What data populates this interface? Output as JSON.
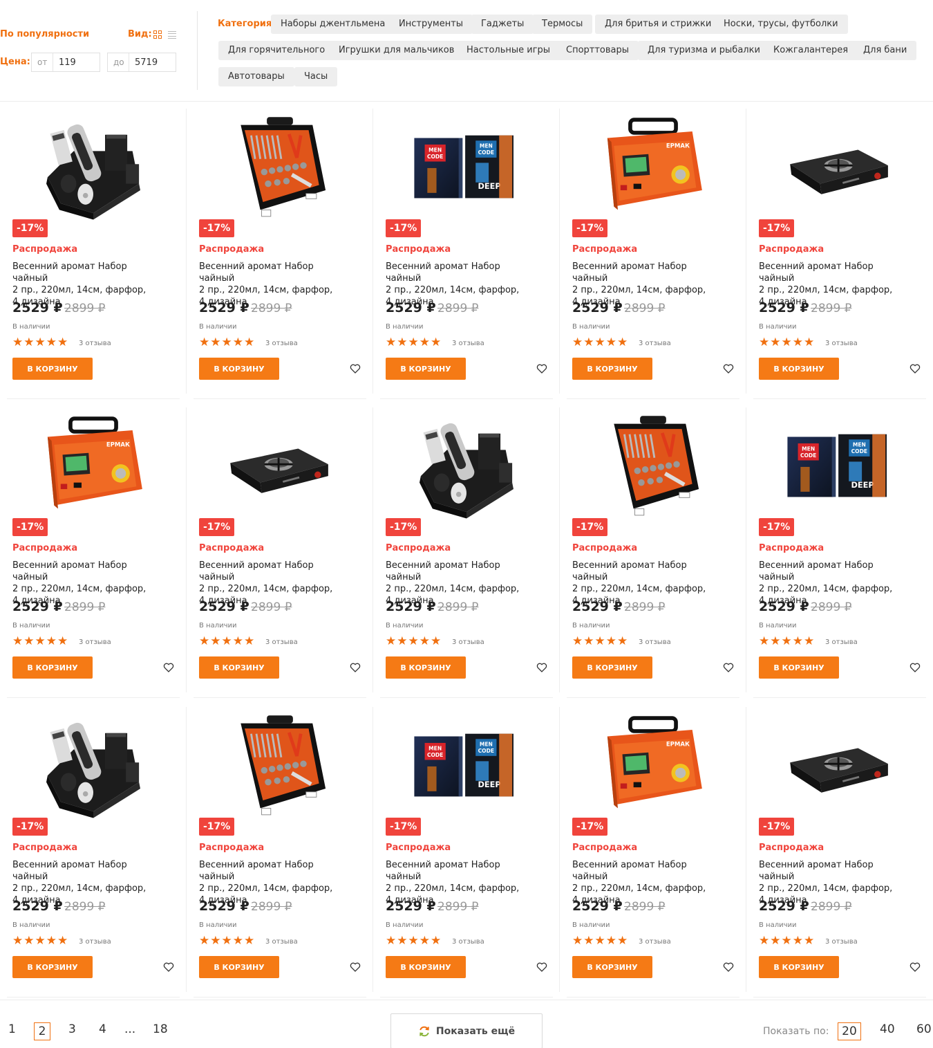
{
  "filters": {
    "sort_label": "По популярности",
    "view_label": "Вид:",
    "price_label": "Цена:",
    "price_from_prefix": "от",
    "price_from_value": "119",
    "price_to_prefix": "до",
    "price_to_value": "5719",
    "category_label": "Категория:",
    "categories": [
      "Наборы джентльмена",
      "Инструменты",
      "Гаджеты",
      "Термосы",
      "Для бритья и стрижки",
      "Носки, трусы, футболки",
      "Для горячительного",
      "Игрушки для мальчиков",
      "Настольные игры",
      "Спорттовары",
      "Для туризма и рыбалки",
      "Кожгалантерея",
      "Для бани",
      "Автотовары",
      "Часы"
    ]
  },
  "products": [
    {
      "image": "trimmer-set-image",
      "discount": "-17%",
      "sale": "Распродажа",
      "title_lines": [
        "Весенний аромат Набор чайный",
        "2 пр., 220мл, 14см, фарфор,",
        "4 дизайна"
      ],
      "price": "2529 ₽",
      "old_price": "2899 ₽",
      "stock": "В наличии",
      "rating": 5,
      "reviews": "3 отзыва",
      "cart": "В КОРЗИНУ"
    },
    {
      "image": "tool-case-image",
      "discount": "-17%",
      "sale": "Распродажа",
      "title_lines": [
        "Весенний аромат Набор чайный",
        "2 пр., 220мл, 14см, фарфор,",
        "4 дизайна"
      ],
      "price": "2529 ₽",
      "old_price": "2899 ₽",
      "stock": "В наличии",
      "rating": 5,
      "reviews": "3 отзыва",
      "cart": "В КОРЗИНУ"
    },
    {
      "image": "men-code-boxes-image",
      "discount": "-17%",
      "sale": "Распродажа",
      "title_lines": [
        "Весенний аромат Набор чайный",
        "2 пр., 220мл, 14см, фарфор,",
        "4 дизайна"
      ],
      "price": "2529 ₽",
      "old_price": "2899 ₽",
      "stock": "В наличии",
      "rating": 5,
      "reviews": "3 отзыва",
      "cart": "В КОРЗИНУ"
    },
    {
      "image": "battery-charger-image",
      "discount": "-17%",
      "sale": "Распродажа",
      "title_lines": [
        "Весенний аромат Набор чайный",
        "2 пр., 220мл, 14см, фарфор,",
        "4 дизайна"
      ],
      "price": "2529 ₽",
      "old_price": "2899 ₽",
      "stock": "В наличии",
      "rating": 5,
      "reviews": "3 отзыва",
      "cart": "В КОРЗИНУ"
    },
    {
      "image": "gas-stove-image",
      "discount": "-17%",
      "sale": "Распродажа",
      "title_lines": [
        "Весенний аромат Набор чайный",
        "2 пр., 220мл, 14см, фарфор,",
        "4 дизайна"
      ],
      "price": "2529 ₽",
      "old_price": "2899 ₽",
      "stock": "В наличии",
      "rating": 5,
      "reviews": "3 отзыва",
      "cart": "В КОРЗИНУ"
    },
    {
      "image": "battery-charger-image",
      "discount": "-17%",
      "sale": "Распродажа",
      "title_lines": [
        "Весенний аромат Набор чайный",
        "2 пр., 220мл, 14см, фарфор,",
        "4 дизайна"
      ],
      "price": "2529 ₽",
      "old_price": "2899 ₽",
      "stock": "В наличии",
      "rating": 5,
      "reviews": "3 отзыва",
      "cart": "В КОРЗИНУ"
    },
    {
      "image": "gas-stove-image",
      "discount": "-17%",
      "sale": "Распродажа",
      "title_lines": [
        "Весенний аромат Набор чайный",
        "2 пр., 220мл, 14см, фарфор,",
        "4 дизайна"
      ],
      "price": "2529 ₽",
      "old_price": "2899 ₽",
      "stock": "В наличии",
      "rating": 5,
      "reviews": "3 отзыва",
      "cart": "В КОРЗИНУ"
    },
    {
      "image": "trimmer-set-image",
      "discount": "-17%",
      "sale": "Распродажа",
      "title_lines": [
        "Весенний аромат Набор чайный",
        "2 пр., 220мл, 14см, фарфор,",
        "4 дизайна"
      ],
      "price": "2529 ₽",
      "old_price": "2899 ₽",
      "stock": "В наличии",
      "rating": 5,
      "reviews": "3 отзыва",
      "cart": "В КОРЗИНУ"
    },
    {
      "image": "tool-case-image",
      "discount": "-17%",
      "sale": "Распродажа",
      "title_lines": [
        "Весенний аромат Набор чайный",
        "2 пр., 220мл, 14см, фарфор,",
        "4 дизайна"
      ],
      "price": "2529 ₽",
      "old_price": "2899 ₽",
      "stock": "В наличии",
      "rating": 5,
      "reviews": "3 отзыва",
      "cart": "В КОРЗИНУ"
    },
    {
      "image": "men-code-boxes-image",
      "discount": "-17%",
      "sale": "Распродажа",
      "title_lines": [
        "Весенний аромат Набор чайный",
        "2 пр., 220мл, 14см, фарфор,",
        "4 дизайна"
      ],
      "price": "2529 ₽",
      "old_price": "2899 ₽",
      "stock": "В наличии",
      "rating": 5,
      "reviews": "3 отзыва",
      "cart": "В КОРЗИНУ"
    },
    {
      "image": "trimmer-set-image",
      "discount": "-17%",
      "sale": "Распродажа",
      "title_lines": [
        "Весенний аромат Набор чайный",
        "2 пр., 220мл, 14см, фарфор,",
        "4 дизайна"
      ],
      "price": "2529 ₽",
      "old_price": "2899 ₽",
      "stock": "В наличии",
      "rating": 5,
      "reviews": "3 отзыва",
      "cart": "В КОРЗИНУ"
    },
    {
      "image": "tool-case-image",
      "discount": "-17%",
      "sale": "Распродажа",
      "title_lines": [
        "Весенний аромат Набор чайный",
        "2 пр., 220мл, 14см, фарфор,",
        "4 дизайна"
      ],
      "price": "2529 ₽",
      "old_price": "2899 ₽",
      "stock": "В наличии",
      "rating": 5,
      "reviews": "3 отзыва",
      "cart": "В КОРЗИНУ"
    },
    {
      "image": "men-code-boxes-image",
      "discount": "-17%",
      "sale": "Распродажа",
      "title_lines": [
        "Весенний аромат Набор чайный",
        "2 пр., 220мл, 14см, фарфор,",
        "4 дизайна"
      ],
      "price": "2529 ₽",
      "old_price": "2899 ₽",
      "stock": "В наличии",
      "rating": 5,
      "reviews": "3 отзыва",
      "cart": "В КОРЗИНУ"
    },
    {
      "image": "battery-charger-image",
      "discount": "-17%",
      "sale": "Распродажа",
      "title_lines": [
        "Весенний аромат Набор чайный",
        "2 пр., 220мл, 14см, фарфор,",
        "4 дизайна"
      ],
      "price": "2529 ₽",
      "old_price": "2899 ₽",
      "stock": "В наличии",
      "rating": 5,
      "reviews": "3 отзыва",
      "cart": "В КОРЗИНУ"
    },
    {
      "image": "gas-stove-image",
      "discount": "-17%",
      "sale": "Распродажа",
      "title_lines": [
        "Весенний аромат Набор чайный",
        "2 пр., 220мл, 14см, фарфор,",
        "4 дизайна"
      ],
      "price": "2529 ₽",
      "old_price": "2899 ₽",
      "stock": "В наличии",
      "rating": 5,
      "reviews": "3 отзыва",
      "cart": "В КОРЗИНУ"
    }
  ],
  "pagination": {
    "pages": [
      "1",
      "2",
      "3",
      "4",
      "...",
      "18"
    ],
    "current_page": "2",
    "show_more_label": "Показать ещё",
    "per_page_label": "Показать по:",
    "per_page_options": [
      "20",
      "40",
      "60"
    ],
    "per_page_selected": "20"
  },
  "colors": {
    "accent": "#f07010",
    "button": "#f57a15",
    "discount_badge": "#f0443c",
    "chip_bg": "#eeeeee"
  },
  "icons": {
    "view_grid": "grid-view-icon",
    "view_list": "list-view-icon",
    "favorite": "heart-icon",
    "show_more": "refresh-icon"
  }
}
